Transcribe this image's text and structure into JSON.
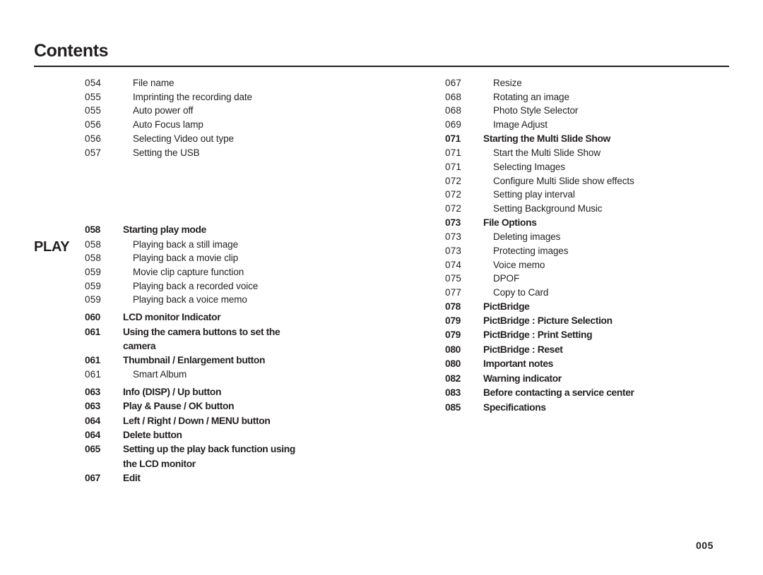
{
  "header": {
    "title": "Contents"
  },
  "section_label": "PLAY",
  "page_number": "005",
  "left_column": [
    {
      "num": "054",
      "text": "File name",
      "style": "sub"
    },
    {
      "num": "055",
      "text": "Imprinting the recording date",
      "style": "sub"
    },
    {
      "num": "055",
      "text": "Auto power off",
      "style": "sub"
    },
    {
      "num": "056",
      "text": "Auto Focus lamp",
      "style": "sub"
    },
    {
      "num": "056",
      "text": "Selecting Video out type",
      "style": "sub"
    },
    {
      "num": "057",
      "text": "Setting the USB",
      "style": "sub"
    },
    {
      "num": "058",
      "text": "Starting play mode",
      "style": "head",
      "gap": "md"
    },
    {
      "num": "058",
      "text": "Playing back a still image",
      "style": "sub"
    },
    {
      "num": "058",
      "text": "Playing back a movie clip",
      "style": "sub"
    },
    {
      "num": "059",
      "text": "Movie clip capture function",
      "style": "sub"
    },
    {
      "num": "059",
      "text": "Playing back a recorded voice",
      "style": "sub"
    },
    {
      "num": "059",
      "text": "Playing back a voice memo",
      "style": "sub"
    },
    {
      "num": "060",
      "text": "LCD monitor Indicator",
      "style": "head",
      "gap": "xs"
    },
    {
      "num": "061",
      "text": "Using the camera buttons to set the",
      "style": "head"
    },
    {
      "num": "",
      "text": "camera",
      "style": "cont"
    },
    {
      "num": "061",
      "text": "Thumbnail / Enlargement button",
      "style": "head"
    },
    {
      "num": "061",
      "text": "Smart Album",
      "style": "sub"
    },
    {
      "num": "063",
      "text": "Info (DISP) / Up button",
      "style": "head",
      "gap": "xs"
    },
    {
      "num": "063",
      "text": "Play & Pause / OK button",
      "style": "head"
    },
    {
      "num": "064",
      "text": "Left / Right / Down / MENU button",
      "style": "head"
    },
    {
      "num": "064",
      "text": "Delete button",
      "style": "head"
    },
    {
      "num": "065",
      "text": "Setting up the play back function using",
      "style": "head"
    },
    {
      "num": "",
      "text": "the LCD monitor",
      "style": "cont"
    },
    {
      "num": "067",
      "text": "Edit",
      "style": "head"
    }
  ],
  "right_column": [
    {
      "num": "067",
      "text": "Resize",
      "style": "sub"
    },
    {
      "num": "068",
      "text": "Rotating an image",
      "style": "sub"
    },
    {
      "num": "068",
      "text": "Photo Style Selector",
      "style": "sub"
    },
    {
      "num": "069",
      "text": "Image Adjust",
      "style": "sub"
    },
    {
      "num": "071",
      "text": "Starting the Multi Slide Show",
      "style": "head"
    },
    {
      "num": "071",
      "text": "Start the Multi Slide Show",
      "style": "sub"
    },
    {
      "num": "071",
      "text": "Selecting Images",
      "style": "sub"
    },
    {
      "num": "072",
      "text": "Configure Multi Slide show effects",
      "style": "sub"
    },
    {
      "num": "072",
      "text": "Setting play interval",
      "style": "sub"
    },
    {
      "num": "072",
      "text": "Setting Background Music",
      "style": "sub"
    },
    {
      "num": "073",
      "text": "File Options",
      "style": "head"
    },
    {
      "num": "073",
      "text": "Deleting images",
      "style": "sub"
    },
    {
      "num": "073",
      "text": "Protecting images",
      "style": "sub"
    },
    {
      "num": "074",
      "text": "Voice memo",
      "style": "sub"
    },
    {
      "num": "075",
      "text": "DPOF",
      "style": "sub"
    },
    {
      "num": "077",
      "text": "Copy to Card",
      "style": "sub"
    },
    {
      "num": "078",
      "text": "PictBridge",
      "style": "head"
    },
    {
      "num": "079",
      "text": "PictBridge : Picture Selection",
      "style": "head"
    },
    {
      "num": "079",
      "text": "PictBridge : Print Setting",
      "style": "head"
    },
    {
      "num": "080",
      "text": "PictBridge : Reset",
      "style": "head"
    },
    {
      "num": "080",
      "text": "Important notes",
      "style": "head"
    },
    {
      "num": "082",
      "text": "Warning indicator",
      "style": "head"
    },
    {
      "num": "083",
      "text": "Before contacting a service center",
      "style": "head"
    },
    {
      "num": "085",
      "text": "Specifications",
      "style": "head"
    }
  ]
}
